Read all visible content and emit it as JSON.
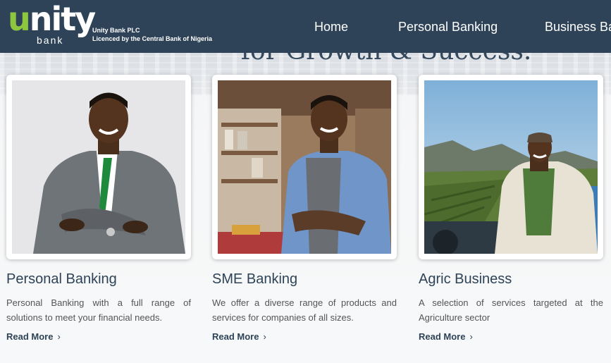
{
  "header": {
    "logo": {
      "word": "unity",
      "sub": "bank"
    },
    "brand_name": "Unity Bank PLC",
    "brand_licence": "Licenced by the Central Bank of Nigeria",
    "nav": [
      {
        "label": "Home"
      },
      {
        "label": "Personal Banking"
      },
      {
        "label": "Business Ba"
      }
    ]
  },
  "hero": {
    "title": "for Growth & Success."
  },
  "cards": [
    {
      "title": "Personal Banking",
      "description": "Personal Banking with a full range of solutions to meet your financial needs.",
      "link": "Read More"
    },
    {
      "title": "SME Banking",
      "description": "We offer a diverse range of products and services for companies of all sizes.",
      "link": "Read More"
    },
    {
      "title": "Agric Business",
      "description": "A selection of services targeted at the Agriculture sector",
      "link": "Read More"
    }
  ],
  "colors": {
    "header_bg": "#2e4357",
    "logo_accent": "#8dc63f",
    "title_text": "#2e4357"
  },
  "icons": {
    "read_more": "chevron-right-icon"
  }
}
